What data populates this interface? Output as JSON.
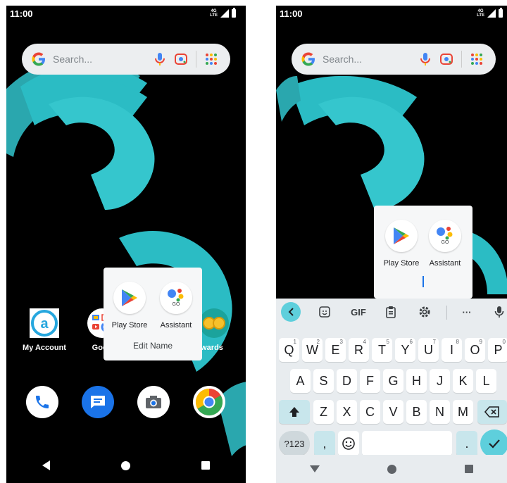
{
  "left_screen": {
    "status": {
      "time": "11:00",
      "network": "4G LTE"
    },
    "search": {
      "placeholder": "Search..."
    },
    "folder": {
      "apps": [
        {
          "label": "Play Store",
          "icon": "play-store-icon"
        },
        {
          "label": "Assistant",
          "icon": "assistant-go-icon"
        }
      ],
      "edit_name_label": "Edit Name"
    },
    "home_apps": [
      {
        "label": "My Account",
        "icon": "my-account-icon"
      },
      {
        "label": "Goog",
        "icon": "google-folder-icon"
      },
      {
        "label": "ewards",
        "icon": "rewards-icon"
      }
    ],
    "dock": [
      {
        "name": "phone",
        "icon": "phone-icon",
        "color": "#1a73e8"
      },
      {
        "name": "messages",
        "icon": "messages-icon",
        "color": "#1a73e8"
      },
      {
        "name": "camera",
        "icon": "camera-icon",
        "color": "#5f6368"
      },
      {
        "name": "chrome",
        "icon": "chrome-icon",
        "color": "#ea4335"
      }
    ]
  },
  "right_screen": {
    "status": {
      "time": "11:00",
      "network": "4G LTE"
    },
    "search": {
      "placeholder": "Search..."
    },
    "folder": {
      "apps": [
        {
          "label": "Play Store",
          "icon": "play-store-icon"
        },
        {
          "label": "Assistant",
          "icon": "assistant-go-icon"
        }
      ]
    },
    "keyboard": {
      "toolbar": [
        "back-chevron-icon",
        "sticker-icon",
        "GIF",
        "clipboard-icon",
        "settings-icon",
        "more-icon",
        "mic-icon"
      ],
      "gif_label": "GIF",
      "more_label": "···",
      "row1": [
        {
          "key": "Q",
          "hint": "1"
        },
        {
          "key": "W",
          "hint": "2"
        },
        {
          "key": "E",
          "hint": "3"
        },
        {
          "key": "R",
          "hint": "4"
        },
        {
          "key": "T",
          "hint": "5"
        },
        {
          "key": "Y",
          "hint": "6"
        },
        {
          "key": "U",
          "hint": "7"
        },
        {
          "key": "I",
          "hint": "8"
        },
        {
          "key": "O",
          "hint": "9"
        },
        {
          "key": "P",
          "hint": "0"
        }
      ],
      "row2": [
        "A",
        "S",
        "D",
        "F",
        "G",
        "H",
        "J",
        "K",
        "L"
      ],
      "row3": [
        "Z",
        "X",
        "C",
        "V",
        "B",
        "N",
        "M"
      ],
      "symbols_label": "?123",
      "comma_label": ",",
      "period_label": ".",
      "accent": "#5ecfdc"
    }
  },
  "colors": {
    "wallpaper_bg": "#000000",
    "wallpaper_accent": "#2bbcc4",
    "search_bg": "#eceef0",
    "keyboard_bg": "#e8ecef"
  }
}
